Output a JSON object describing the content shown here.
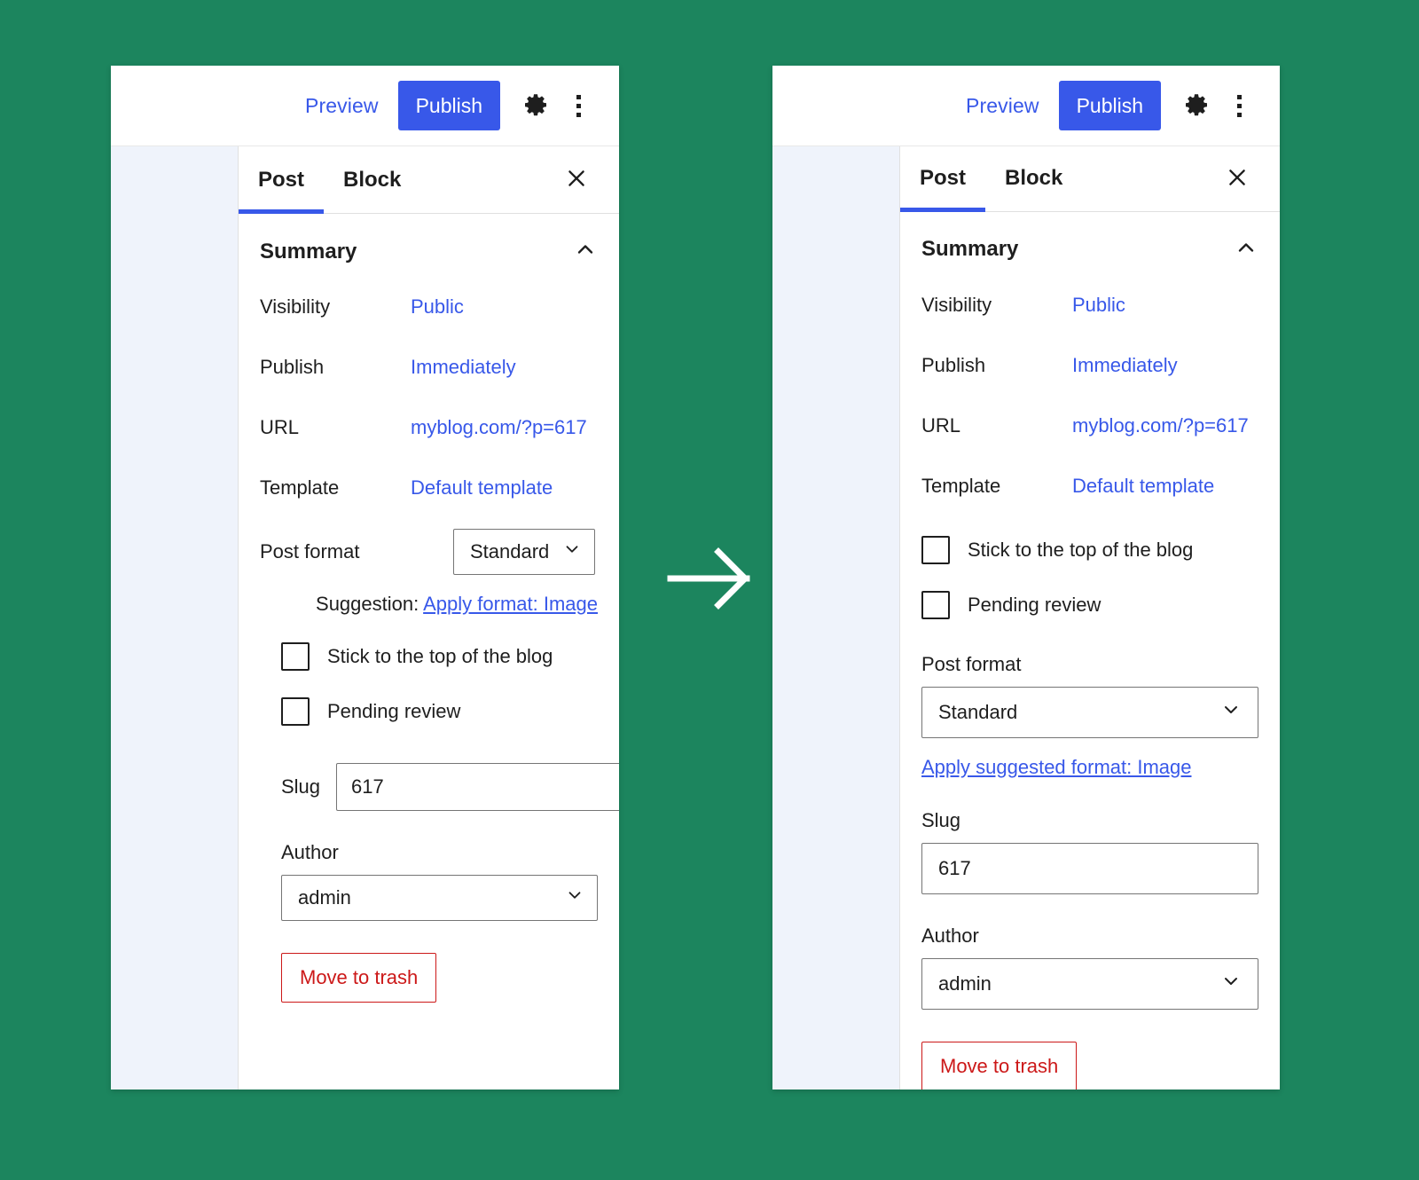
{
  "background_color": "#1c855e",
  "accent_color": "#3858e9",
  "danger_color": "#cc1818",
  "rail_color": "#eff3fb",
  "toolbar": {
    "preview_label": "Preview",
    "publish_label": "Publish",
    "settings_icon": "gear-icon",
    "more_icon": "kebab-menu-icon"
  },
  "tabs": {
    "post_label": "Post",
    "block_label": "Block",
    "close_icon": "close-icon",
    "active": "Post"
  },
  "summary": {
    "title": "Summary",
    "collapse_icon": "chevron-up-icon"
  },
  "fields": {
    "visibility_label": "Visibility",
    "visibility_value": "Public",
    "publish_label": "Publish",
    "publish_value": "Immediately",
    "url_label": "URL",
    "url_value": "myblog.com/?p=617",
    "template_label": "Template",
    "template_value": "Default template",
    "post_format_label": "Post format",
    "post_format_value": "Standard",
    "stick_label": "Stick to the top of the blog",
    "pending_label": "Pending review",
    "slug_label": "Slug",
    "slug_value": "617",
    "author_label": "Author",
    "author_value": "admin",
    "trash_label": "Move to trash"
  },
  "variant_before": {
    "suggestion_prefix": "Suggestion: ",
    "suggestion_link": "Apply format: Image"
  },
  "variant_after": {
    "suggestion_link": "Apply suggested format: Image"
  },
  "transition": {
    "arrow_icon": "arrow-right-icon"
  }
}
